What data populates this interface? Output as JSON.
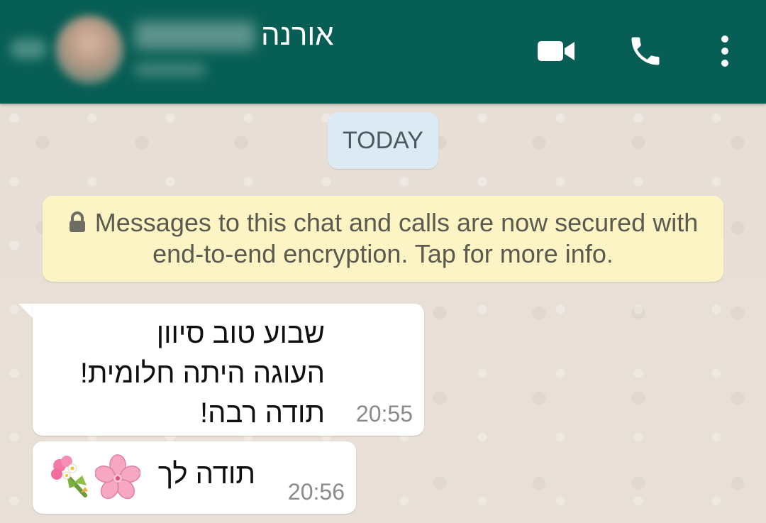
{
  "header": {
    "contact_name": "אורנה",
    "colors": {
      "bar": "#075e54",
      "icon": "#ffffff"
    },
    "icons": [
      "video-call-icon",
      "voice-call-icon",
      "more-options-icon"
    ]
  },
  "chat": {
    "date_label": "TODAY",
    "encryption_notice": "Messages to this chat and calls are now secured with end-to-end encryption. Tap for more info.",
    "messages": [
      {
        "direction": "incoming",
        "lines": [
          "שבוע טוב סיוון",
          "העוגה היתה חלומית!",
          "תודה רבה!"
        ],
        "time": "20:55"
      },
      {
        "direction": "incoming",
        "text": "תודה לך",
        "emojis": [
          "cherry-blossom-icon",
          "bouquet-icon"
        ],
        "time": "20:56"
      }
    ]
  }
}
